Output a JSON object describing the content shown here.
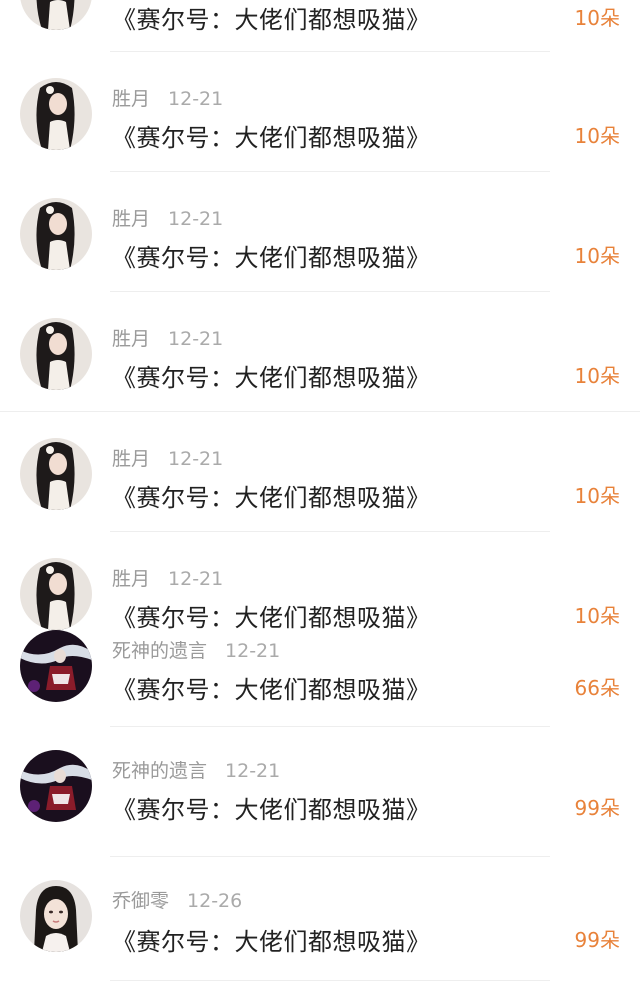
{
  "list": {
    "items": [
      {
        "user": "",
        "date": "",
        "title": "《赛尔号：大佬们都想吸猫》",
        "amount": "10朵",
        "avatar": "girl-longhair-avatar"
      },
      {
        "user": "胜月",
        "date": "12-21",
        "title": "《赛尔号：大佬们都想吸猫》",
        "amount": "10朵",
        "avatar": "girl-longhair-avatar"
      },
      {
        "user": "胜月",
        "date": "12-21",
        "title": "《赛尔号：大佬们都想吸猫》",
        "amount": "10朵",
        "avatar": "girl-longhair-avatar"
      },
      {
        "user": "胜月",
        "date": "12-21",
        "title": "《赛尔号：大佬们都想吸猫》",
        "amount": "10朵",
        "avatar": "girl-longhair-avatar"
      },
      {
        "user": "胜月",
        "date": "12-21",
        "title": "《赛尔号：大佬们都想吸猫》",
        "amount": "10朵",
        "avatar": "girl-longhair-avatar"
      },
      {
        "user": "胜月",
        "date": "12-21",
        "title": "《赛尔号：大佬们都想吸猫》",
        "amount": "10朵",
        "avatar": "girl-longhair-avatar"
      },
      {
        "user": "死神的遗言",
        "date": "12-21",
        "title": "《赛尔号：大佬们都想吸猫》",
        "amount": "66朵",
        "avatar": "anime-warrior-avatar"
      },
      {
        "user": "死神的遗言",
        "date": "12-21",
        "title": "《赛尔号：大佬们都想吸猫》",
        "amount": "99朵",
        "avatar": "anime-warrior-avatar"
      },
      {
        "user": "乔御零",
        "date": "12-26",
        "title": "《赛尔号：大佬们都想吸猫》",
        "amount": "99朵",
        "avatar": "portrait-girl-avatar"
      }
    ]
  },
  "colors": {
    "amount": "#e8823a",
    "title": "#222222",
    "meta": "#9a9a9a",
    "divider": "#eeeeee"
  }
}
